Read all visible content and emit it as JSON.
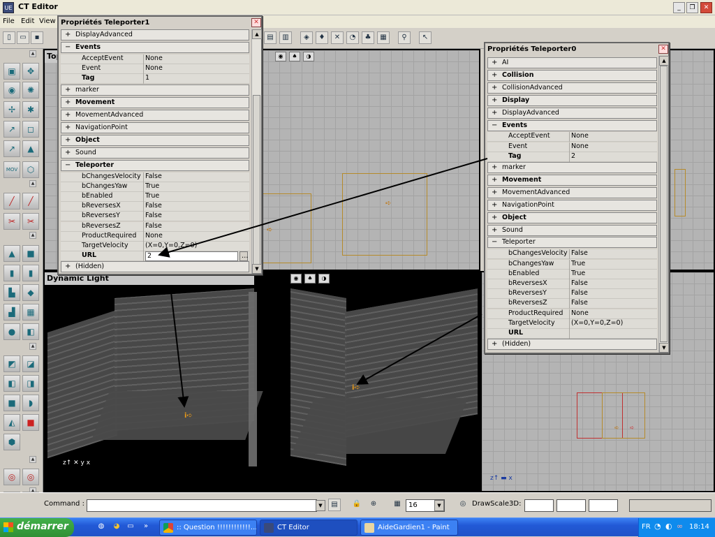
{
  "window": {
    "title": "CT Editor",
    "icon_text": "UE"
  },
  "menu": [
    "File",
    "Edit",
    "View"
  ],
  "viewports": {
    "top_label": "Top",
    "perspective_label": "Dynamic Light"
  },
  "panel1": {
    "title": "Propriétés Teleporter1",
    "sections": [
      {
        "label": "DisplayAdvanced",
        "bold": false,
        "expander": "+"
      },
      {
        "label": "Events",
        "bold": true,
        "expander": "−"
      },
      {
        "label": "marker",
        "bold": false,
        "expander": "+"
      },
      {
        "label": "Movement",
        "bold": true,
        "expander": "+"
      },
      {
        "label": "MovementAdvanced",
        "bold": false,
        "expander": "+"
      },
      {
        "label": "NavigationPoint",
        "bold": false,
        "expander": "+"
      },
      {
        "label": "Object",
        "bold": true,
        "expander": "+"
      },
      {
        "label": "Sound",
        "bold": false,
        "expander": "+"
      },
      {
        "label": "Teleporter",
        "bold": true,
        "expander": "−"
      },
      {
        "label": "(Hidden)",
        "bold": false,
        "expander": "+"
      }
    ],
    "events_props": [
      {
        "name": "AcceptEvent",
        "value": "None"
      },
      {
        "name": "Event",
        "value": "None"
      },
      {
        "name": "Tag",
        "value": "1"
      }
    ],
    "teleporter_props": [
      {
        "name": "bChangesVelocity",
        "value": "False"
      },
      {
        "name": "bChangesYaw",
        "value": "True"
      },
      {
        "name": "bEnabled",
        "value": "True"
      },
      {
        "name": "bReversesX",
        "value": "False"
      },
      {
        "name": "bReversesY",
        "value": "False"
      },
      {
        "name": "bReversesZ",
        "value": "False"
      },
      {
        "name": "ProductRequired",
        "value": "None"
      },
      {
        "name": "TargetVelocity",
        "value": "(X=0,Y=0,Z=0)"
      },
      {
        "name": "URL",
        "value": "2"
      }
    ]
  },
  "panel2": {
    "title": "Propriétés Teleporter0",
    "sections": [
      {
        "label": "AI",
        "bold": false,
        "expander": "+"
      },
      {
        "label": "Collision",
        "bold": true,
        "expander": "+"
      },
      {
        "label": "CollisionAdvanced",
        "bold": false,
        "expander": "+"
      },
      {
        "label": "Display",
        "bold": true,
        "expander": "+"
      },
      {
        "label": "DisplayAdvanced",
        "bold": false,
        "expander": "+"
      },
      {
        "label": "Events",
        "bold": true,
        "expander": "−"
      },
      {
        "label": "marker",
        "bold": false,
        "expander": "+"
      },
      {
        "label": "Movement",
        "bold": true,
        "expander": "+"
      },
      {
        "label": "MovementAdvanced",
        "bold": false,
        "expander": "+"
      },
      {
        "label": "NavigationPoint",
        "bold": false,
        "expander": "+"
      },
      {
        "label": "Object",
        "bold": true,
        "expander": "+"
      },
      {
        "label": "Sound",
        "bold": false,
        "expander": "+"
      },
      {
        "label": "Teleporter",
        "bold": false,
        "expander": "−"
      },
      {
        "label": "(Hidden)",
        "bold": false,
        "expander": "+"
      }
    ],
    "events_props": [
      {
        "name": "AcceptEvent",
        "value": "None"
      },
      {
        "name": "Event",
        "value": "None"
      },
      {
        "name": "Tag",
        "value": "2"
      }
    ],
    "teleporter_props": [
      {
        "name": "bChangesVelocity",
        "value": "False"
      },
      {
        "name": "bChangesYaw",
        "value": "True"
      },
      {
        "name": "bEnabled",
        "value": "True"
      },
      {
        "name": "bReversesX",
        "value": "False"
      },
      {
        "name": "bReversesY",
        "value": "False"
      },
      {
        "name": "bReversesZ",
        "value": "False"
      },
      {
        "name": "ProductRequired",
        "value": "None"
      },
      {
        "name": "TargetVelocity",
        "value": "(X=0,Y=0,Z=0)"
      },
      {
        "name": "URL",
        "value": ""
      }
    ]
  },
  "command_bar": {
    "label": "Command :",
    "value": "",
    "grid_value": "16",
    "drawscale_label": "DrawScale3D:"
  },
  "taskbar": {
    "start": "démarrer",
    "tasks": [
      ":: Question !!!!!!!!!!!!...",
      "CT Editor",
      "AideGardien1 - Paint"
    ],
    "lang": "FR",
    "clock": "18:14"
  }
}
